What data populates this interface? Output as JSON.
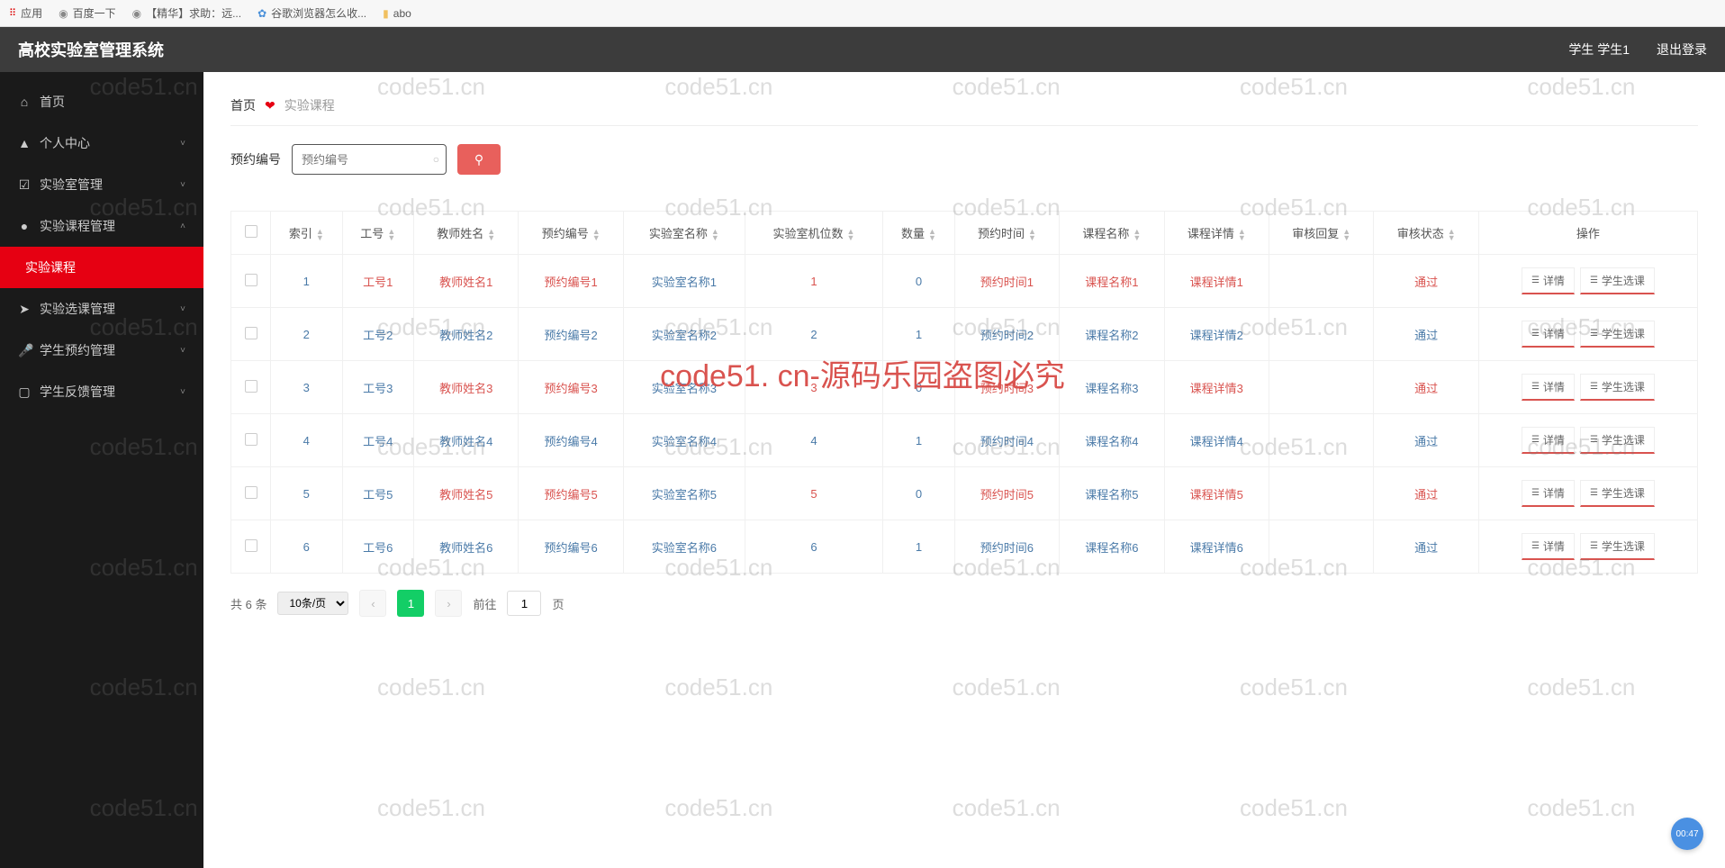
{
  "bookmarks": {
    "apps": "应用",
    "baidu": "百度一下",
    "jinghua": "【精华】求助：远...",
    "google": "谷歌浏览器怎么收...",
    "abo": "abo"
  },
  "header": {
    "title": "高校实验室管理系统",
    "user": "学生 学生1",
    "logout": "退出登录"
  },
  "sidebar": {
    "items": [
      {
        "label": "首页",
        "icon": "⌂",
        "expand": ""
      },
      {
        "label": "个人中心",
        "icon": "▲",
        "expand": "˅"
      },
      {
        "label": "实验室管理",
        "icon": "☑",
        "expand": "˅"
      },
      {
        "label": "实验课程管理",
        "icon": "●",
        "expand": "˄"
      },
      {
        "label": "实验课程",
        "icon": "",
        "expand": ""
      },
      {
        "label": "实验选课管理",
        "icon": "➤",
        "expand": "˅"
      },
      {
        "label": "学生预约管理",
        "icon": "🎤",
        "expand": "˅"
      },
      {
        "label": "学生反馈管理",
        "icon": "▢",
        "expand": "˅"
      }
    ]
  },
  "breadcrumb": {
    "home": "首页",
    "current": "实验课程"
  },
  "search": {
    "label": "预约编号",
    "placeholder": "预约编号"
  },
  "table": {
    "headers": [
      "索引",
      "工号",
      "教师姓名",
      "预约编号",
      "实验室名称",
      "实验室机位数",
      "数量",
      "预约时间",
      "课程名称",
      "课程详情",
      "审核回复",
      "审核状态",
      "操作"
    ],
    "detail_btn": "详情",
    "select_btn": "学生选课",
    "rows": [
      {
        "idx": "1",
        "gh": "工号1",
        "teacher": "教师姓名1",
        "rno": "预约编号1",
        "lab": "实验室名称1",
        "seats": "1",
        "qty": "0",
        "time": "预约时间1",
        "course": "课程名称1",
        "detail": "课程详情1",
        "reply": "",
        "status": "通过"
      },
      {
        "idx": "2",
        "gh": "工号2",
        "teacher": "教师姓名2",
        "rno": "预约编号2",
        "lab": "实验室名称2",
        "seats": "2",
        "qty": "1",
        "time": "预约时间2",
        "course": "课程名称2",
        "detail": "课程详情2",
        "reply": "",
        "status": "通过"
      },
      {
        "idx": "3",
        "gh": "工号3",
        "teacher": "教师姓名3",
        "rno": "预约编号3",
        "lab": "实验室名称3",
        "seats": "3",
        "qty": "0",
        "time": "预约时间3",
        "course": "课程名称3",
        "detail": "课程详情3",
        "reply": "",
        "status": "通过"
      },
      {
        "idx": "4",
        "gh": "工号4",
        "teacher": "教师姓名4",
        "rno": "预约编号4",
        "lab": "实验室名称4",
        "seats": "4",
        "qty": "1",
        "time": "预约时间4",
        "course": "课程名称4",
        "detail": "课程详情4",
        "reply": "",
        "status": "通过"
      },
      {
        "idx": "5",
        "gh": "工号5",
        "teacher": "教师姓名5",
        "rno": "预约编号5",
        "lab": "实验室名称5",
        "seats": "5",
        "qty": "0",
        "time": "预约时间5",
        "course": "课程名称5",
        "detail": "课程详情5",
        "reply": "",
        "status": "通过"
      },
      {
        "idx": "6",
        "gh": "工号6",
        "teacher": "教师姓名6",
        "rno": "预约编号6",
        "lab": "实验室名称6",
        "seats": "6",
        "qty": "1",
        "time": "预约时间6",
        "course": "课程名称6",
        "detail": "课程详情6",
        "reply": "",
        "status": "通过"
      }
    ]
  },
  "pagination": {
    "total": "共 6 条",
    "pagesize": "10条/页",
    "current": "1",
    "goto_pre": "前往",
    "goto_val": "1",
    "goto_post": "页"
  },
  "watermark": {
    "small": "code51.cn",
    "big": "code51. cn-源码乐园盗图必究"
  },
  "timer": "00:47"
}
